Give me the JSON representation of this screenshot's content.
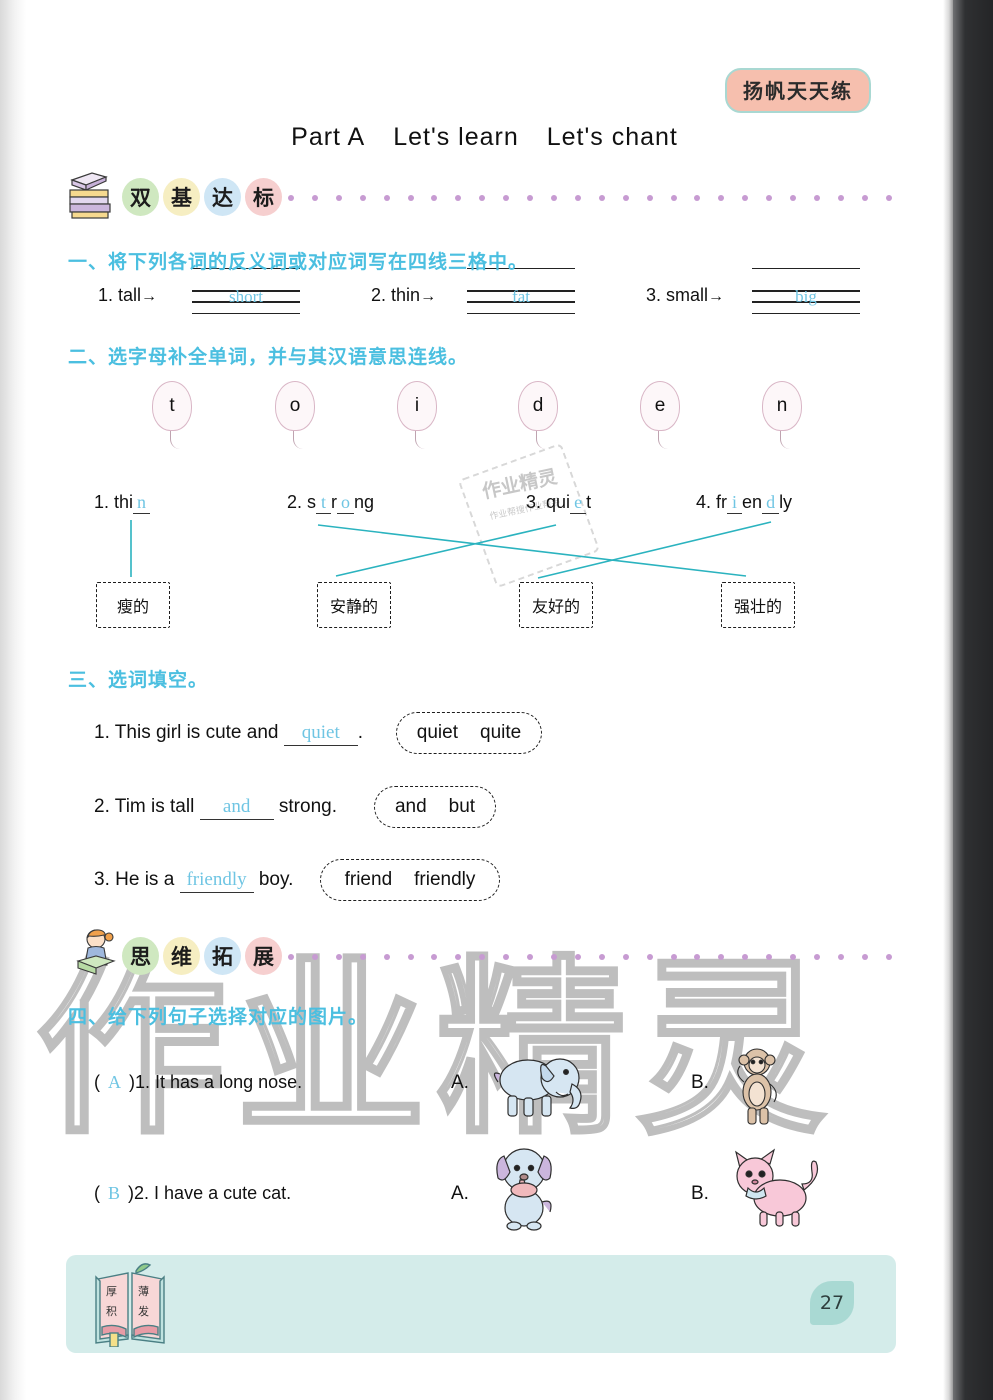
{
  "brand": {
    "badge": "扬帆天天练"
  },
  "part_title": {
    "part": "Part A",
    "sec1": "Let's learn",
    "sec2": "Let's chant"
  },
  "sections": [
    {
      "name": "双基达标",
      "chars": [
        "双",
        "基",
        "达",
        "标"
      ],
      "icon": "book-stack-icon"
    },
    {
      "name": "思维拓展",
      "chars": [
        "思",
        "维",
        "拓",
        "展"
      ],
      "icon": "girl-reading-icon"
    }
  ],
  "exercise1": {
    "heading": "一、将下列各词的反义词或对应词写在四线三格中。",
    "items": [
      {
        "num": "1.",
        "word": "tall",
        "arrow": "→",
        "answer": "short"
      },
      {
        "num": "2.",
        "word": "thin",
        "arrow": "→",
        "answer": "fat"
      },
      {
        "num": "3.",
        "word": "small",
        "arrow": "→",
        "answer": "big"
      }
    ]
  },
  "exercise2": {
    "heading": "二、选字母补全单词，并与其汉语意思连线。",
    "balloons": [
      "t",
      "o",
      "i",
      "d",
      "e",
      "n"
    ],
    "words": [
      {
        "num": "1.",
        "pre": "thi",
        "fill1": "n",
        "mid": "",
        "fill2": "",
        "post": ""
      },
      {
        "num": "2.",
        "pre": "s",
        "fill1": "t",
        "mid": "r",
        "fill2": "o",
        "post": "ng"
      },
      {
        "num": "3.",
        "pre": "qui",
        "fill1": "e",
        "mid": "",
        "fill2": "",
        "post": "t"
      },
      {
        "num": "4.",
        "pre": "fr",
        "fill1": "i",
        "mid": "en",
        "fill2": "d",
        "post": "ly"
      }
    ],
    "meanings": [
      "瘦的",
      "安静的",
      "友好的",
      "强壮的"
    ],
    "matches": [
      {
        "from_word": 1,
        "to_meaning": "瘦的"
      },
      {
        "from_word": 2,
        "to_meaning": "强壮的"
      },
      {
        "from_word": 3,
        "to_meaning": "安静的"
      },
      {
        "from_word": 4,
        "to_meaning": "友好的"
      }
    ]
  },
  "exercise3": {
    "heading": "三、选词填空。",
    "items": [
      {
        "num": "1.",
        "before": "This girl is cute and",
        "answer": "quiet",
        "after": ".",
        "options": [
          "quiet",
          "quite"
        ]
      },
      {
        "num": "2.",
        "before": "Tim is tall",
        "answer": "and",
        "after": "strong.",
        "options": [
          "and",
          "but"
        ]
      },
      {
        "num": "3.",
        "before": "He is a",
        "answer": "friendly",
        "after": "boy.",
        "options": [
          "friend",
          "friendly"
        ]
      }
    ]
  },
  "exercise4": {
    "heading": "四、给下列句子选择对应的图片。",
    "items": [
      {
        "answer": "A",
        "num": "1.",
        "sentence": "It has a long nose.",
        "optA_label": "A.",
        "optA_pic": "elephant-image",
        "optB_label": "B.",
        "optB_pic": "monkey-image"
      },
      {
        "answer": "B",
        "num": "2.",
        "sentence": "I have a cute cat.",
        "optA_label": "A.",
        "optA_pic": "dog-image",
        "optB_label": "B.",
        "optB_pic": "pink-cat-image"
      }
    ]
  },
  "footer": {
    "motto": [
      "厚",
      "积",
      "薄",
      "发"
    ],
    "page": "27"
  },
  "watermark": {
    "big": "作业精灵",
    "stamp_main": "作业精灵",
    "stamp_sub": "作业帮搜作业帮手"
  },
  "colors": {
    "heading_blue": "#4bbfe0",
    "answer_blue": "#6fc5e3",
    "badge_pink": "#f6bfae",
    "badge_border": "#a9d8d2",
    "footer_bg": "#d4ecea",
    "match_line": "#2bb3bf",
    "dot_purple": "#c79bd2"
  }
}
